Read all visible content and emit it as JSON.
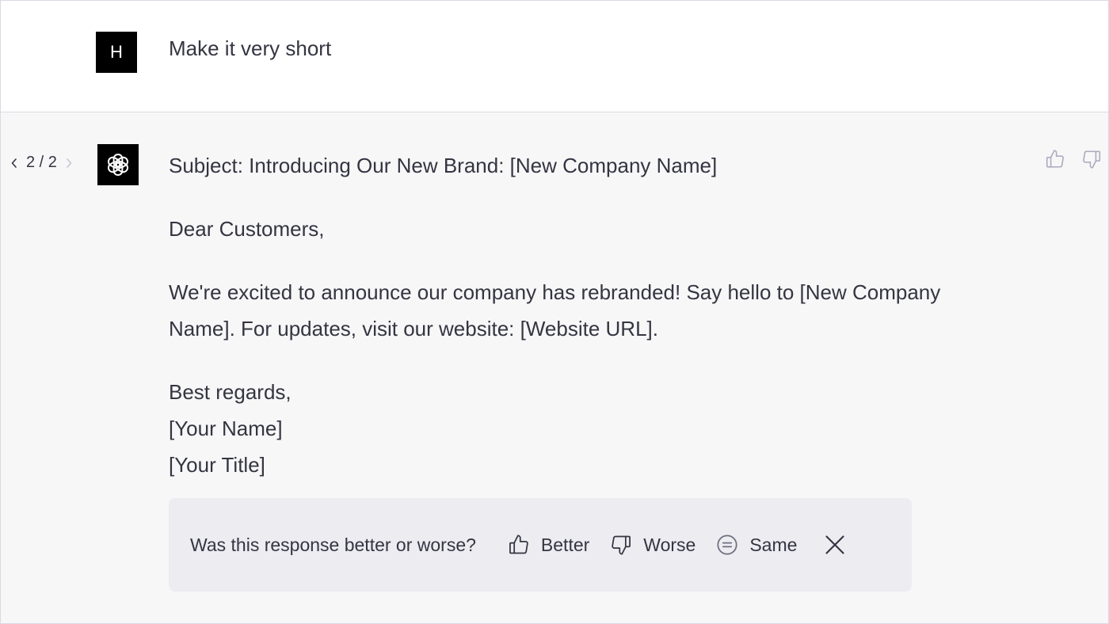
{
  "user_message": {
    "avatar_letter": "H",
    "text": "Make it very short"
  },
  "assistant_message": {
    "pager": {
      "current": "2 / 2"
    },
    "avatar_icon": "openai-logo-icon",
    "paragraphs": [
      [
        "Subject: Introducing Our New Brand: [New Company Name]"
      ],
      [
        "Dear Customers,"
      ],
      [
        "We're excited to announce our company has rebranded! Say hello to [New Company",
        "Name]. For updates, visit our website: [Website URL]."
      ],
      [
        "Best regards,",
        "[Your Name]",
        "[Your Title]"
      ]
    ],
    "top_actions": {
      "thumbs_up_icon": "thumbs-up-icon",
      "thumbs_down_icon": "thumbs-down-icon"
    }
  },
  "feedback": {
    "question": "Was this response better or worse?",
    "better_label": "Better",
    "worse_label": "Worse",
    "same_label": "Same"
  },
  "colors": {
    "text": "#343541",
    "user_bg": "#ffffff",
    "assistant_bg": "#f7f7f8",
    "feedback_bg": "#ececf1",
    "avatar_bg": "#000000",
    "icon_muted": "#acacbe"
  }
}
